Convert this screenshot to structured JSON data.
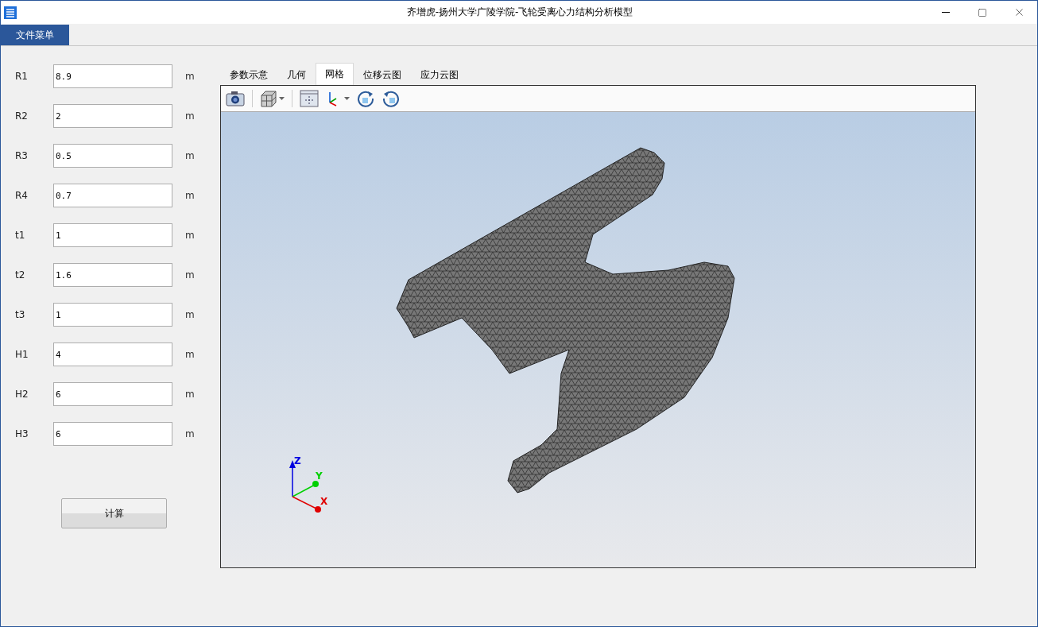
{
  "window": {
    "title": "齐增虎-扬州大学广陵学院-飞轮受离心力结构分析模型"
  },
  "menu": [
    {
      "label": "文件菜单",
      "selected": true
    }
  ],
  "parameters": [
    {
      "name": "R1",
      "value": "8.9",
      "unit": "m"
    },
    {
      "name": "R2",
      "value": "2",
      "unit": "m"
    },
    {
      "name": "R3",
      "value": "0.5",
      "unit": "m"
    },
    {
      "name": "R4",
      "value": "0.7",
      "unit": "m"
    },
    {
      "name": "t1",
      "value": "1",
      "unit": "m"
    },
    {
      "name": "t2",
      "value": "1.6",
      "unit": "m"
    },
    {
      "name": "t3",
      "value": "1",
      "unit": "m"
    },
    {
      "name": "H1",
      "value": "4",
      "unit": "m"
    },
    {
      "name": "H2",
      "value": "6",
      "unit": "m"
    },
    {
      "name": "H3",
      "value": "6",
      "unit": "m"
    }
  ],
  "calculate_button": "计算",
  "tabs": [
    {
      "label": "参数示意",
      "selected": false
    },
    {
      "label": "几何",
      "selected": false
    },
    {
      "label": "网格",
      "selected": true
    },
    {
      "label": "位移云图",
      "selected": false
    },
    {
      "label": "应力云图",
      "selected": false
    }
  ],
  "viewer": {
    "axes": {
      "x": "X",
      "y": "Y",
      "z": "Z"
    }
  }
}
